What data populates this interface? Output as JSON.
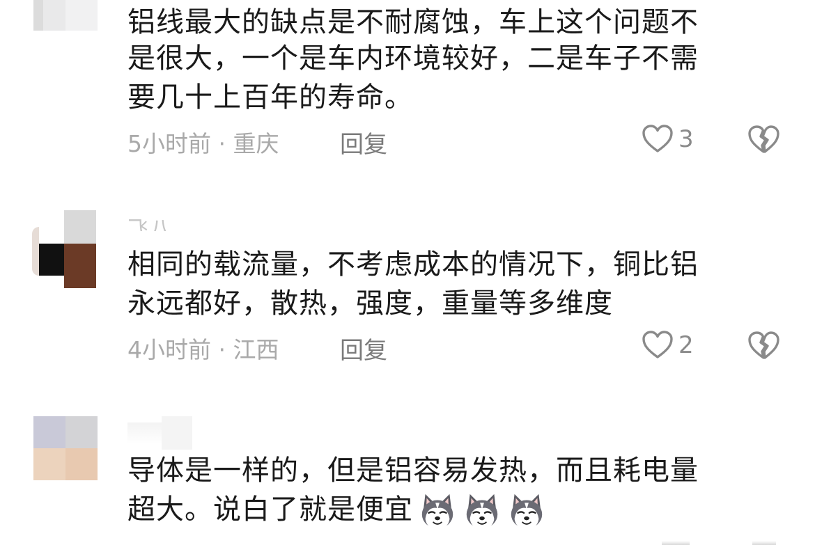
{
  "comments": [
    {
      "username": "",
      "lines": [
        "铝线最大的缺点是不耐腐蚀，车上这个问题不",
        "是很大，一个是车内环境较好，二是车子不需",
        "要几十上百年的寿命。"
      ],
      "time": "5小时前",
      "separator": "·",
      "location": "重庆",
      "reply_label": "回复",
      "likes": "3"
    },
    {
      "username": "飞八",
      "lines": [
        "相同的载流量，不考虑成本的情况下，铜比铝",
        "永远都好，散热，强度，重量等多维度"
      ],
      "time": "4小时前",
      "separator": "·",
      "location": "江西",
      "reply_label": "回复",
      "likes": "2"
    },
    {
      "username": "",
      "lines": [
        "导体是一样的，但是铝容易发热，而且耗电量",
        "超大。说白了就是便宜"
      ],
      "emojis": [
        "husky-emoji",
        "husky-emoji",
        "husky-emoji"
      ]
    }
  ],
  "icons": {
    "like": "heart-outline-icon",
    "dislike": "broken-heart-icon"
  },
  "colors": {
    "text": "#1a1a1a",
    "meta": "#a9a9a9",
    "reply": "#7a7a7a",
    "icon": "#8a8a8a"
  }
}
